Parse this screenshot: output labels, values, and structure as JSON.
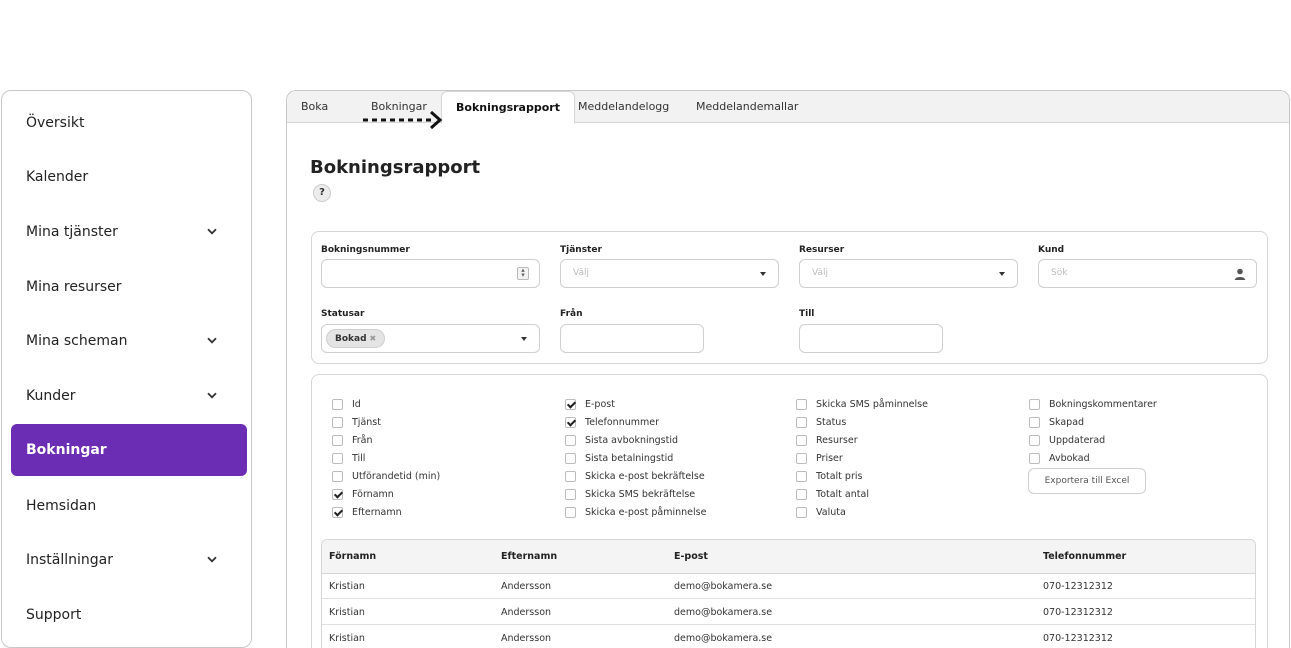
{
  "sidebar": {
    "items": [
      {
        "label": "Översikt",
        "has_chevron": false
      },
      {
        "label": "Kalender",
        "has_chevron": false
      },
      {
        "label": "Mina tjänster",
        "has_chevron": true
      },
      {
        "label": "Mina resurser",
        "has_chevron": false
      },
      {
        "label": "Mina scheman",
        "has_chevron": true
      },
      {
        "label": "Kunder",
        "has_chevron": true
      },
      {
        "label": "Bokningar",
        "has_chevron": false,
        "active": true
      },
      {
        "label": "Hemsidan",
        "has_chevron": false
      },
      {
        "label": "Inställningar",
        "has_chevron": true
      },
      {
        "label": "Support",
        "has_chevron": false
      }
    ],
    "accent_color": "#6a2db3"
  },
  "tabs": [
    {
      "label": "Boka"
    },
    {
      "label": "Bokningar"
    },
    {
      "label": "Bokningsrapport",
      "active": true
    },
    {
      "label": "Meddelandelogg"
    },
    {
      "label": "Meddelandemallar"
    }
  ],
  "page": {
    "title": "Bokningsrapport",
    "help_label": "?"
  },
  "filters": {
    "booking_number": {
      "label": "Bokningsnummer",
      "value": ""
    },
    "services": {
      "label": "Tjänster",
      "placeholder": "Välj"
    },
    "resources": {
      "label": "Resurser",
      "placeholder": "Välj"
    },
    "customer": {
      "label": "Kund",
      "placeholder": "Sök"
    },
    "statuses": {
      "label": "Statusar",
      "selected_tag": "Bokad"
    },
    "from": {
      "label": "Från",
      "value": ""
    },
    "to": {
      "label": "Till",
      "value": ""
    }
  },
  "columns_options": {
    "col1": [
      {
        "label": "Id",
        "checked": false
      },
      {
        "label": "Tjänst",
        "checked": false
      },
      {
        "label": "Från",
        "checked": false
      },
      {
        "label": "Till",
        "checked": false
      },
      {
        "label": "Utförandetid (min)",
        "checked": false
      },
      {
        "label": "Förnamn",
        "checked": true
      },
      {
        "label": "Efternamn",
        "checked": true
      }
    ],
    "col2": [
      {
        "label": "E-post",
        "checked": true
      },
      {
        "label": "Telefonnummer",
        "checked": true
      },
      {
        "label": "Sista avbokningstid",
        "checked": false
      },
      {
        "label": "Sista betalningstid",
        "checked": false
      },
      {
        "label": "Skicka e-post bekräftelse",
        "checked": false
      },
      {
        "label": "Skicka SMS bekräftelse",
        "checked": false
      },
      {
        "label": "Skicka e-post påminnelse",
        "checked": false
      }
    ],
    "col3": [
      {
        "label": "Skicka SMS påminnelse",
        "checked": false
      },
      {
        "label": "Status",
        "checked": false
      },
      {
        "label": "Resurser",
        "checked": false
      },
      {
        "label": "Priser",
        "checked": false
      },
      {
        "label": "Totalt pris",
        "checked": false
      },
      {
        "label": "Totalt antal",
        "checked": false
      },
      {
        "label": "Valuta",
        "checked": false
      }
    ],
    "col4": [
      {
        "label": "Bokningskommentarer",
        "checked": false
      },
      {
        "label": "Skapad",
        "checked": false
      },
      {
        "label": "Uppdaterad",
        "checked": false
      },
      {
        "label": "Avbokad",
        "checked": false
      }
    ],
    "export_label": "Exportera till Excel"
  },
  "table": {
    "headers": [
      "Förnamn",
      "Efternamn",
      "E-post",
      "Telefonnummer"
    ],
    "rows": [
      [
        "Kristian",
        "Andersson",
        "demo@bokamera.se",
        "070-12312312"
      ],
      [
        "Kristian",
        "Andersson",
        "demo@bokamera.se",
        "070-12312312"
      ],
      [
        "Kristian",
        "Andersson",
        "demo@bokamera.se",
        "070-12312312"
      ]
    ]
  }
}
